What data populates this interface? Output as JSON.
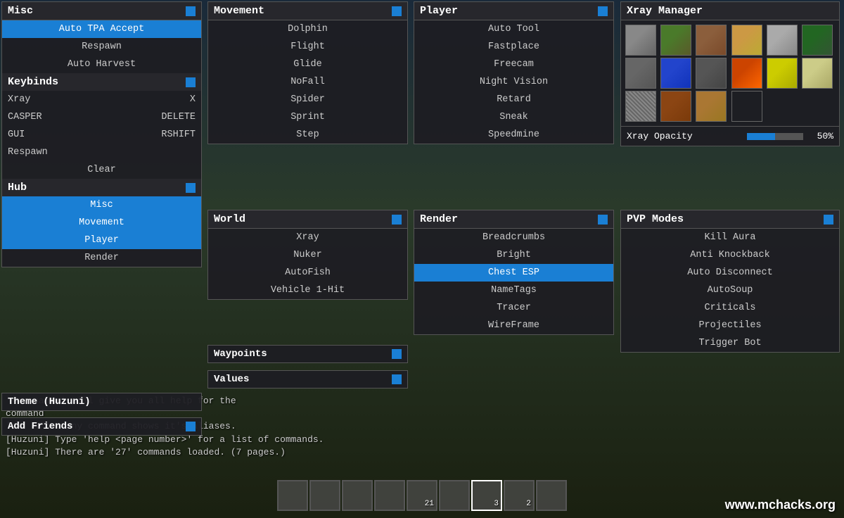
{
  "background": {
    "color": "#2a3a2a"
  },
  "watermark": "www.mchacks.org",
  "chat": {
    "lines": [
      "'<command>' will give you all help for the",
      "command",
      "'es' after any command shows it's aliases.",
      "[Huzuni] Type 'help <page number>' for a list of commands.",
      "[Huzuni] There are '27' commands loaded. (7 pages.)"
    ]
  },
  "misc_panel": {
    "title": "Misc",
    "items": [
      {
        "label": "Auto TPA Accept",
        "active": true
      },
      {
        "label": "Respawn",
        "active": false
      },
      {
        "label": "Auto Harvest",
        "active": false
      }
    ],
    "keybinds_title": "Keybinds",
    "keybinds": [
      {
        "label": "Xray",
        "key": "X"
      },
      {
        "label": "CASPER",
        "key": "DELETE"
      },
      {
        "label": "GUI",
        "key": "RSHIFT"
      },
      {
        "label": "Respawn",
        "key": ""
      }
    ],
    "clear_label": "Clear",
    "hub_title": "Hub",
    "hub_items": [
      {
        "label": "Misc",
        "active": true
      },
      {
        "label": "Movement",
        "active": true
      },
      {
        "label": "Player",
        "active": true
      },
      {
        "label": "Render",
        "active": false
      }
    ]
  },
  "movement_panel": {
    "title": "Movement",
    "items": [
      {
        "label": "Dolphin",
        "active": false
      },
      {
        "label": "Flight",
        "active": false
      },
      {
        "label": "Glide",
        "active": false
      },
      {
        "label": "NoFall",
        "active": false
      },
      {
        "label": "Spider",
        "active": false
      },
      {
        "label": "Sprint",
        "active": false
      },
      {
        "label": "Step",
        "active": false
      }
    ]
  },
  "player_panel": {
    "title": "Player",
    "items": [
      {
        "label": "Auto Tool",
        "active": false
      },
      {
        "label": "Fastplace",
        "active": false
      },
      {
        "label": "Freecam",
        "active": false
      },
      {
        "label": "Night Vision",
        "active": false
      },
      {
        "label": "Retard",
        "active": false
      },
      {
        "label": "Sneak",
        "active": false
      },
      {
        "label": "Speedmine",
        "active": false
      }
    ]
  },
  "xray_panel": {
    "title": "Xray Manager",
    "opacity_label": "Xray Opacity",
    "opacity_value": "50%",
    "opacity_percent": 50,
    "blocks": [
      {
        "color": "#888888",
        "type": "stone"
      },
      {
        "color": "#4a7a2a",
        "type": "grass"
      },
      {
        "color": "#8B6914",
        "type": "dirt-brown"
      },
      {
        "color": "#cc8833",
        "type": "sand"
      },
      {
        "color": "#aaaaaa",
        "type": "gravel"
      },
      {
        "color": "#226622",
        "type": "leaves"
      },
      {
        "color": "#555555",
        "type": "stone2"
      },
      {
        "color": "#2244cc",
        "type": "water"
      },
      {
        "color": "#444444",
        "type": "stone3"
      },
      {
        "color": "#cc4400",
        "type": "lava"
      },
      {
        "color": "#cccc00",
        "type": "sand2"
      },
      {
        "color": "#888844",
        "type": "sandstone"
      },
      {
        "color": "#777777",
        "type": "cobblestone"
      },
      {
        "color": "#8B4513",
        "type": "wood"
      },
      {
        "color": "#996633",
        "type": "wood2"
      },
      {
        "color": "#33aa33",
        "type": "grass2"
      },
      {
        "color": "#999999",
        "type": "block1"
      },
      {
        "color": "#555555",
        "type": "block2"
      }
    ]
  },
  "world_panel": {
    "title": "World",
    "items": [
      {
        "label": "Xray",
        "active": false
      },
      {
        "label": "Nuker",
        "active": false
      },
      {
        "label": "AutoFish",
        "active": false
      },
      {
        "label": "Vehicle 1-Hit",
        "active": false
      }
    ]
  },
  "render_panel": {
    "title": "Render",
    "items": [
      {
        "label": "Breadcrumbs",
        "active": false
      },
      {
        "label": "Bright",
        "active": false
      },
      {
        "label": "Chest ESP",
        "active": true
      },
      {
        "label": "NameTags",
        "active": false
      },
      {
        "label": "Tracer",
        "active": false
      },
      {
        "label": "WireFrame",
        "active": false
      }
    ]
  },
  "pvp_panel": {
    "title": "PVP Modes",
    "items": [
      {
        "label": "Kill Aura",
        "active": false
      },
      {
        "label": "Anti Knockback",
        "active": false
      },
      {
        "label": "Auto Disconnect",
        "active": false
      },
      {
        "label": "AutoSoup",
        "active": false
      },
      {
        "label": "Criticals",
        "active": false
      },
      {
        "label": "Projectiles",
        "active": false
      },
      {
        "label": "Trigger Bot",
        "active": false
      }
    ]
  },
  "waypoints_panel": {
    "title": "Waypoints"
  },
  "values_panel": {
    "title": "Values"
  },
  "theme_panel": {
    "title": "Theme (Huzuni)"
  },
  "add_friends_panel": {
    "title": "Add Friends"
  },
  "accent_color": "#1a7fd4",
  "hotbar": {
    "slots": [
      {
        "count": "",
        "active": false
      },
      {
        "count": "",
        "active": false
      },
      {
        "count": "",
        "active": false
      },
      {
        "count": "",
        "active": false
      },
      {
        "count": "21",
        "active": false
      },
      {
        "count": "",
        "active": false
      },
      {
        "count": "3",
        "active": true
      },
      {
        "count": "2",
        "active": false
      },
      {
        "count": "",
        "active": false
      }
    ]
  }
}
